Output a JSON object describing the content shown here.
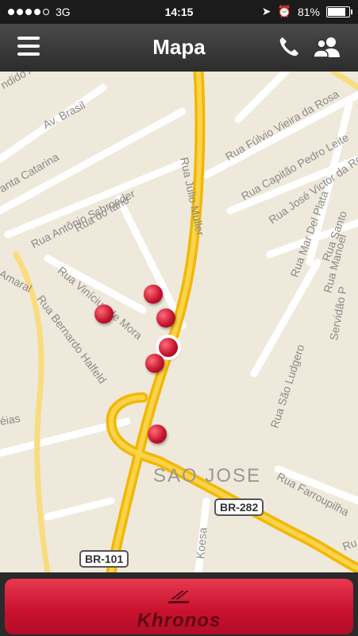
{
  "status": {
    "carrier": "3G",
    "time": "14:15",
    "battery": "81%"
  },
  "header": {
    "title": "Mapa"
  },
  "map": {
    "district": "SAO JOSE",
    "streets": [
      "ndido A",
      "Av. Brasil",
      "anta Catarina",
      "Rua Antônio Schroeder",
      "Rua do Iano",
      "Amaral",
      "Rua Vinícius de Mora",
      "Rua Bernardo Halfeld",
      "éias",
      "Rua Júlio Muller",
      "Rua Fúlvio Vieira da Rosa",
      "Rua Capitão Pedro Leite",
      "Rua José Victor da Rosa",
      "Rua Mar Del Plata",
      "Rua Santo",
      "Rua Manoel",
      "Servidão P",
      "Rua São Ludgero",
      "Rua Farroupilha",
      "Koesa",
      "Ru"
    ],
    "highways": [
      "BR-282",
      "BR-101"
    ]
  },
  "footer": {
    "logo_text": "Khronos"
  },
  "colors": {
    "accent": "#c8102e",
    "road": "#f5c431",
    "background": "#efe9dc"
  }
}
